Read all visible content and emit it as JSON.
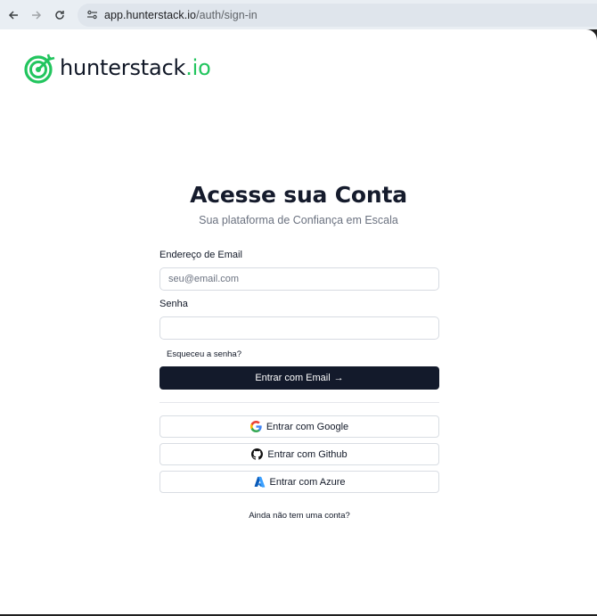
{
  "browser": {
    "url_host": "app.hunterstack.io",
    "url_path": "/auth/sign-in"
  },
  "brand": {
    "name": "hunterstack",
    "tld": ".io",
    "accent_color": "#22c55e",
    "logo_icon": "target-arrow-icon"
  },
  "auth": {
    "title": "Acesse sua Conta",
    "subtitle": "Sua plataforma de Confiança em Escala",
    "email_label": "Endereço de Email",
    "email_placeholder": "seu@email.com",
    "email_value": "",
    "password_label": "Senha",
    "password_value": "",
    "forgot_link": "Esqueceu a senha?",
    "email_button": "Entrar com Email",
    "email_button_arrow": "→",
    "oauth": [
      {
        "label": "Entrar com Google",
        "icon": "google-icon"
      },
      {
        "label": "Entrar com Github",
        "icon": "github-icon"
      },
      {
        "label": "Entrar com Azure",
        "icon": "azure-icon"
      }
    ],
    "signup_link": "Ainda não tem uma conta?"
  },
  "colors": {
    "primary_button": "#131a2b",
    "page_bg": "#ffffff",
    "chrome_bg": "#e9eef3"
  }
}
